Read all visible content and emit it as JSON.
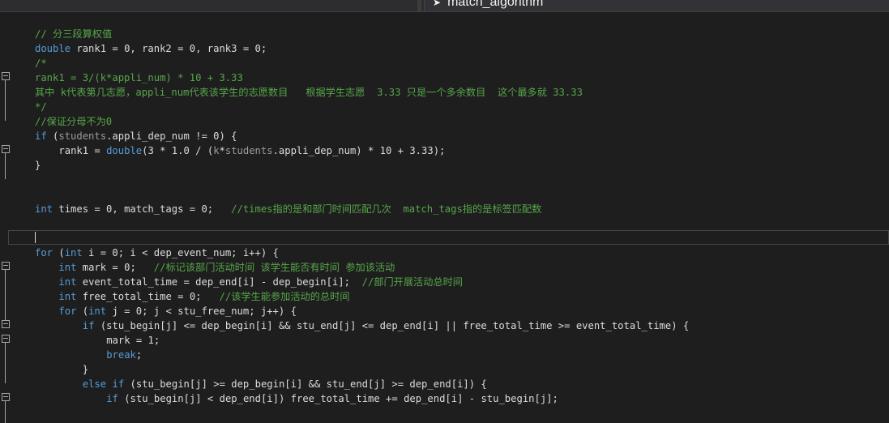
{
  "tab": {
    "label": "match_algorithm"
  },
  "code_lines": [
    {
      "indent": 0,
      "tokens": [
        {
          "t": "// 分三段算权值",
          "c": "cm"
        }
      ]
    },
    {
      "indent": 0,
      "tokens": [
        {
          "t": "double",
          "c": "kw"
        },
        {
          "t": " rank1 = 0, rank2 = 0, rank3 = 0;",
          "c": ""
        }
      ]
    },
    {
      "indent": 0,
      "tokens": [
        {
          "t": "/*",
          "c": "cm"
        }
      ]
    },
    {
      "indent": 0,
      "tokens": [
        {
          "t": "rank1 = 3/(k*appli_num) * 10 + 3.33",
          "c": "cm"
        }
      ]
    },
    {
      "indent": 0,
      "tokens": [
        {
          "t": "其中 k代表第几志愿，appli_num代表该学生的志愿数目   根据学生志愿  3.33 只是一个多余数目  这个最多就 33.33",
          "c": "cm"
        }
      ]
    },
    {
      "indent": 0,
      "tokens": [
        {
          "t": "*/",
          "c": "cm"
        }
      ]
    },
    {
      "indent": 0,
      "tokens": [
        {
          "t": "//保证分母不为0",
          "c": "cm"
        }
      ]
    },
    {
      "indent": 0,
      "tokens": [
        {
          "t": "if",
          "c": "kw"
        },
        {
          "t": " (",
          "c": ""
        },
        {
          "t": "students",
          "c": "gr"
        },
        {
          "t": ".appli_dep_num != 0) {",
          "c": ""
        }
      ]
    },
    {
      "indent": 1,
      "tokens": [
        {
          "t": "rank1 = ",
          "c": ""
        },
        {
          "t": "double",
          "c": "kw"
        },
        {
          "t": "(3 * 1.0 / (",
          "c": ""
        },
        {
          "t": "k",
          "c": "gr"
        },
        {
          "t": "*",
          "c": ""
        },
        {
          "t": "students",
          "c": "gr"
        },
        {
          "t": ".appli_dep_num) * 10 + 3.33);",
          "c": ""
        }
      ]
    },
    {
      "indent": 0,
      "tokens": [
        {
          "t": "}",
          "c": ""
        }
      ]
    },
    {
      "indent": 0,
      "tokens": []
    },
    {
      "indent": 0,
      "tokens": []
    },
    {
      "indent": 0,
      "tokens": [
        {
          "t": "int",
          "c": "kw"
        },
        {
          "t": " times = 0, match_tags = 0;   ",
          "c": ""
        },
        {
          "t": "//times指的是和部门时间匹配几次  match_tags指的是标签匹配数",
          "c": "cm"
        }
      ]
    },
    {
      "indent": 0,
      "tokens": []
    },
    {
      "indent": 0,
      "tokens": []
    },
    {
      "indent": 0,
      "tokens": [
        {
          "t": "for",
          "c": "kw"
        },
        {
          "t": " (",
          "c": ""
        },
        {
          "t": "int",
          "c": "kw"
        },
        {
          "t": " i = 0; i < dep_event_num; i++) {",
          "c": ""
        }
      ]
    },
    {
      "indent": 1,
      "tokens": [
        {
          "t": "int",
          "c": "kw"
        },
        {
          "t": " mark = 0;   ",
          "c": ""
        },
        {
          "t": "//标记该部门活动时间 该学生能否有时间 参加该活动",
          "c": "cm"
        }
      ]
    },
    {
      "indent": 1,
      "tokens": [
        {
          "t": "int",
          "c": "kw"
        },
        {
          "t": " event_total_time = dep_end[i] - dep_begin[i];  ",
          "c": ""
        },
        {
          "t": "//部门开展活动总时间",
          "c": "cm"
        }
      ]
    },
    {
      "indent": 1,
      "tokens": [
        {
          "t": "int",
          "c": "kw"
        },
        {
          "t": " free_total_time = 0;   ",
          "c": ""
        },
        {
          "t": "//该学生能参加活动的总时间",
          "c": "cm"
        }
      ]
    },
    {
      "indent": 1,
      "tokens": [
        {
          "t": "for",
          "c": "kw"
        },
        {
          "t": " (",
          "c": ""
        },
        {
          "t": "int",
          "c": "kw"
        },
        {
          "t": " j = 0; j < stu_free_num; j++) {",
          "c": ""
        }
      ]
    },
    {
      "indent": 2,
      "tokens": [
        {
          "t": "if",
          "c": "kw"
        },
        {
          "t": " (stu_begin[j] <= dep_begin[i] && stu_end[j] <= dep_end[i] || free_total_time >= event_total_time) {",
          "c": ""
        }
      ]
    },
    {
      "indent": 3,
      "tokens": [
        {
          "t": "mark = 1;",
          "c": ""
        }
      ]
    },
    {
      "indent": 3,
      "tokens": [
        {
          "t": "break",
          "c": "kw"
        },
        {
          "t": ";",
          "c": ""
        }
      ]
    },
    {
      "indent": 2,
      "tokens": [
        {
          "t": "}",
          "c": ""
        }
      ]
    },
    {
      "indent": 2,
      "tokens": [
        {
          "t": "else",
          "c": "kw"
        },
        {
          "t": " ",
          "c": ""
        },
        {
          "t": "if",
          "c": "kw"
        },
        {
          "t": " (stu_begin[j] >= dep_begin[i] && stu_end[j] >= dep_end[i]) {",
          "c": ""
        }
      ]
    },
    {
      "indent": 3,
      "tokens": [
        {
          "t": "if",
          "c": "kw"
        },
        {
          "t": " (stu_begin[j] < dep_end[i]) free_total_time += dep_end[i] - stu_begin[j];",
          "c": ""
        }
      ]
    }
  ],
  "colors": {
    "background": "#1e1e1e",
    "keyword": "#569cd6",
    "comment": "#57a64a",
    "text": "#dcdcdc"
  }
}
